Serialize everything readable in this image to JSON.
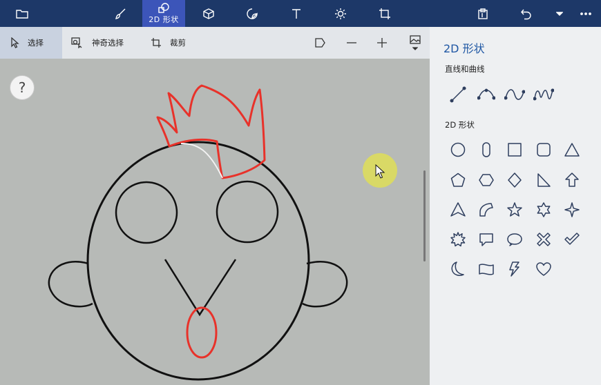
{
  "topbar": {
    "active_tab_label": "2D 形状",
    "tools": [
      "folder-icon",
      "brush-icon",
      "2d-shapes-icon",
      "3d-shapes-icon",
      "sticker-icon",
      "text-icon",
      "effects-icon",
      "canvas-icon",
      "paste-icon",
      "undo-icon",
      "history-dropdown-icon",
      "more-icon"
    ]
  },
  "subbar": {
    "select_label": "选择",
    "magic_select_label": "神奇选择",
    "crop_label": "裁剪"
  },
  "canvas": {
    "help_label": "?"
  },
  "panel": {
    "title": "2D 形状",
    "lines_section": "直线和曲线",
    "shapes_section": "2D 形状",
    "lines": [
      "line",
      "curve",
      "two-point-curve",
      "three-point-curve"
    ],
    "shapes": [
      "circle",
      "pill",
      "square",
      "rounded-square",
      "triangle",
      "pentagon",
      "hexagon",
      "diamond",
      "right-triangle",
      "arrow-up",
      "arrowhead",
      "quarter-circle",
      "star-5",
      "star-6",
      "star-4",
      "burst",
      "speech-rectangle",
      "speech-round",
      "cross",
      "checkmark",
      "moon",
      "banner",
      "lightning",
      "heart"
    ]
  },
  "colors": {
    "topbar_bg": "#1d3868",
    "active_tab": "#3c55b9",
    "canvas_bg": "#b7bab7",
    "drawing_red": "#e8322a",
    "panel_title": "#1f57a4"
  }
}
